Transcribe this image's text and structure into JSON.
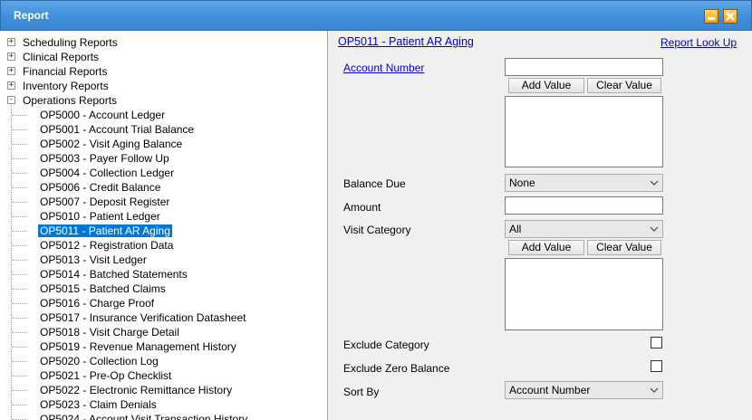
{
  "window": {
    "title": "Report"
  },
  "tree": {
    "groups": [
      {
        "label": "Scheduling Reports",
        "expander": "+"
      },
      {
        "label": "Clinical Reports",
        "expander": "+"
      },
      {
        "label": "Financial Reports",
        "expander": "+"
      },
      {
        "label": "Inventory Reports",
        "expander": "+"
      },
      {
        "label": "Operations Reports",
        "expander": "-"
      }
    ],
    "items": [
      "OP5000 - Account Ledger",
      "OP5001 - Account Trial Balance",
      "OP5002 - Visit Aging Balance",
      "OP5003 - Payer Follow Up",
      "OP5004 - Collection Ledger",
      "OP5006 - Credit Balance",
      "OP5007 - Deposit Register",
      "OP5010 - Patient Ledger",
      "OP5011 - Patient AR Aging",
      "OP5012 - Registration Data",
      "OP5013 - Visit Ledger",
      "OP5014 - Batched Statements",
      "OP5015 - Batched Claims",
      "OP5016 - Charge Proof",
      "OP5017 - Insurance Verification Datasheet",
      "OP5018 - Visit Charge Detail",
      "OP5019 - Revenue Management History",
      "OP5020 - Collection Log",
      "OP5021 - Pre-Op Checklist",
      "OP5022 - Electronic Remittance History",
      "OP5023 - Claim Denials",
      "OP5024 - Account Visit Transaction History"
    ],
    "selected": "OP5011 - Patient AR Aging"
  },
  "form": {
    "report_title": "OP5011 - Patient AR Aging",
    "lookup_link": "Report Look Up",
    "account_number_label": "Account Number",
    "account_number_value": "",
    "add_value_label": "Add Value",
    "clear_value_label": "Clear Value",
    "balance_due_label": "Balance Due",
    "balance_due_value": "None",
    "amount_label": "Amount",
    "amount_value": "",
    "visit_category_label": "Visit Category",
    "visit_category_value": "All",
    "exclude_category_label": "Exclude Category",
    "exclude_zero_label": "Exclude Zero Balance",
    "sort_by_label": "Sort By",
    "sort_by_value": "Account Number"
  }
}
